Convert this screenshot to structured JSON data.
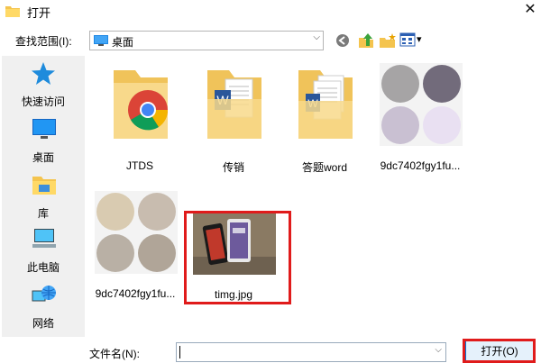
{
  "window": {
    "title": "打开",
    "close": "✕"
  },
  "toolbar": {
    "lookin_label": "查找范围(I):",
    "lookin_value": "桌面",
    "lookin_arrow": "⌵",
    "view_arrow": "▾"
  },
  "places": [
    {
      "label": "快速访问",
      "icon": "star-icon"
    },
    {
      "label": "桌面",
      "icon": "desktop-icon"
    },
    {
      "label": "库",
      "icon": "library-icon"
    },
    {
      "label": "此电脑",
      "icon": "computer-icon"
    },
    {
      "label": "网络",
      "icon": "network-icon"
    }
  ],
  "files": [
    {
      "label": "JTDS",
      "kind": "folder-chrome"
    },
    {
      "label": "传销",
      "kind": "folder-word"
    },
    {
      "label": "答题word",
      "kind": "folder-word"
    },
    {
      "label": "9dc7402fgy1fu...",
      "kind": "image-circles-purple"
    },
    {
      "label": "9dc7402fgy1fu...",
      "kind": "image-circles-beige"
    },
    {
      "label": "timg.jpg",
      "kind": "image-phones"
    }
  ],
  "colors": {
    "purple_circles": [
      "#a6a4a5",
      "#726b7b",
      "#c9c0d2",
      "#e9e0f2"
    ],
    "beige_circles": [
      "#d9cbb1",
      "#c8bcaf",
      "#b9b0a5",
      "#b0a598"
    ],
    "highlight": "#e01b1b",
    "folder": "#f4d27a"
  },
  "bottom": {
    "filename_label": "文件名(N):",
    "filename_value": "",
    "filename_arrow": "⌵",
    "open_button": "打开(O)"
  }
}
